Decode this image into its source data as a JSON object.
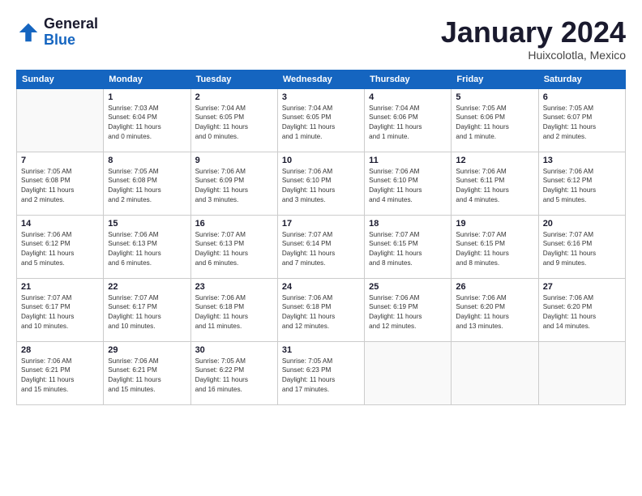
{
  "header": {
    "logo_line1": "General",
    "logo_line2": "Blue",
    "title": "January 2024",
    "location": "Huixcolotla, Mexico"
  },
  "days_of_week": [
    "Sunday",
    "Monday",
    "Tuesday",
    "Wednesday",
    "Thursday",
    "Friday",
    "Saturday"
  ],
  "weeks": [
    [
      {
        "day": "",
        "info": ""
      },
      {
        "day": "1",
        "info": "Sunrise: 7:03 AM\nSunset: 6:04 PM\nDaylight: 11 hours\nand 0 minutes."
      },
      {
        "day": "2",
        "info": "Sunrise: 7:04 AM\nSunset: 6:05 PM\nDaylight: 11 hours\nand 0 minutes."
      },
      {
        "day": "3",
        "info": "Sunrise: 7:04 AM\nSunset: 6:05 PM\nDaylight: 11 hours\nand 1 minute."
      },
      {
        "day": "4",
        "info": "Sunrise: 7:04 AM\nSunset: 6:06 PM\nDaylight: 11 hours\nand 1 minute."
      },
      {
        "day": "5",
        "info": "Sunrise: 7:05 AM\nSunset: 6:06 PM\nDaylight: 11 hours\nand 1 minute."
      },
      {
        "day": "6",
        "info": "Sunrise: 7:05 AM\nSunset: 6:07 PM\nDaylight: 11 hours\nand 2 minutes."
      }
    ],
    [
      {
        "day": "7",
        "info": "Sunrise: 7:05 AM\nSunset: 6:08 PM\nDaylight: 11 hours\nand 2 minutes."
      },
      {
        "day": "8",
        "info": "Sunrise: 7:05 AM\nSunset: 6:08 PM\nDaylight: 11 hours\nand 2 minutes."
      },
      {
        "day": "9",
        "info": "Sunrise: 7:06 AM\nSunset: 6:09 PM\nDaylight: 11 hours\nand 3 minutes."
      },
      {
        "day": "10",
        "info": "Sunrise: 7:06 AM\nSunset: 6:10 PM\nDaylight: 11 hours\nand 3 minutes."
      },
      {
        "day": "11",
        "info": "Sunrise: 7:06 AM\nSunset: 6:10 PM\nDaylight: 11 hours\nand 4 minutes."
      },
      {
        "day": "12",
        "info": "Sunrise: 7:06 AM\nSunset: 6:11 PM\nDaylight: 11 hours\nand 4 minutes."
      },
      {
        "day": "13",
        "info": "Sunrise: 7:06 AM\nSunset: 6:12 PM\nDaylight: 11 hours\nand 5 minutes."
      }
    ],
    [
      {
        "day": "14",
        "info": "Sunrise: 7:06 AM\nSunset: 6:12 PM\nDaylight: 11 hours\nand 5 minutes."
      },
      {
        "day": "15",
        "info": "Sunrise: 7:06 AM\nSunset: 6:13 PM\nDaylight: 11 hours\nand 6 minutes."
      },
      {
        "day": "16",
        "info": "Sunrise: 7:07 AM\nSunset: 6:13 PM\nDaylight: 11 hours\nand 6 minutes."
      },
      {
        "day": "17",
        "info": "Sunrise: 7:07 AM\nSunset: 6:14 PM\nDaylight: 11 hours\nand 7 minutes."
      },
      {
        "day": "18",
        "info": "Sunrise: 7:07 AM\nSunset: 6:15 PM\nDaylight: 11 hours\nand 8 minutes."
      },
      {
        "day": "19",
        "info": "Sunrise: 7:07 AM\nSunset: 6:15 PM\nDaylight: 11 hours\nand 8 minutes."
      },
      {
        "day": "20",
        "info": "Sunrise: 7:07 AM\nSunset: 6:16 PM\nDaylight: 11 hours\nand 9 minutes."
      }
    ],
    [
      {
        "day": "21",
        "info": "Sunrise: 7:07 AM\nSunset: 6:17 PM\nDaylight: 11 hours\nand 10 minutes."
      },
      {
        "day": "22",
        "info": "Sunrise: 7:07 AM\nSunset: 6:17 PM\nDaylight: 11 hours\nand 10 minutes."
      },
      {
        "day": "23",
        "info": "Sunrise: 7:06 AM\nSunset: 6:18 PM\nDaylight: 11 hours\nand 11 minutes."
      },
      {
        "day": "24",
        "info": "Sunrise: 7:06 AM\nSunset: 6:18 PM\nDaylight: 11 hours\nand 12 minutes."
      },
      {
        "day": "25",
        "info": "Sunrise: 7:06 AM\nSunset: 6:19 PM\nDaylight: 11 hours\nand 12 minutes."
      },
      {
        "day": "26",
        "info": "Sunrise: 7:06 AM\nSunset: 6:20 PM\nDaylight: 11 hours\nand 13 minutes."
      },
      {
        "day": "27",
        "info": "Sunrise: 7:06 AM\nSunset: 6:20 PM\nDaylight: 11 hours\nand 14 minutes."
      }
    ],
    [
      {
        "day": "28",
        "info": "Sunrise: 7:06 AM\nSunset: 6:21 PM\nDaylight: 11 hours\nand 15 minutes."
      },
      {
        "day": "29",
        "info": "Sunrise: 7:06 AM\nSunset: 6:21 PM\nDaylight: 11 hours\nand 15 minutes."
      },
      {
        "day": "30",
        "info": "Sunrise: 7:05 AM\nSunset: 6:22 PM\nDaylight: 11 hours\nand 16 minutes."
      },
      {
        "day": "31",
        "info": "Sunrise: 7:05 AM\nSunset: 6:23 PM\nDaylight: 11 hours\nand 17 minutes."
      },
      {
        "day": "",
        "info": ""
      },
      {
        "day": "",
        "info": ""
      },
      {
        "day": "",
        "info": ""
      }
    ]
  ]
}
